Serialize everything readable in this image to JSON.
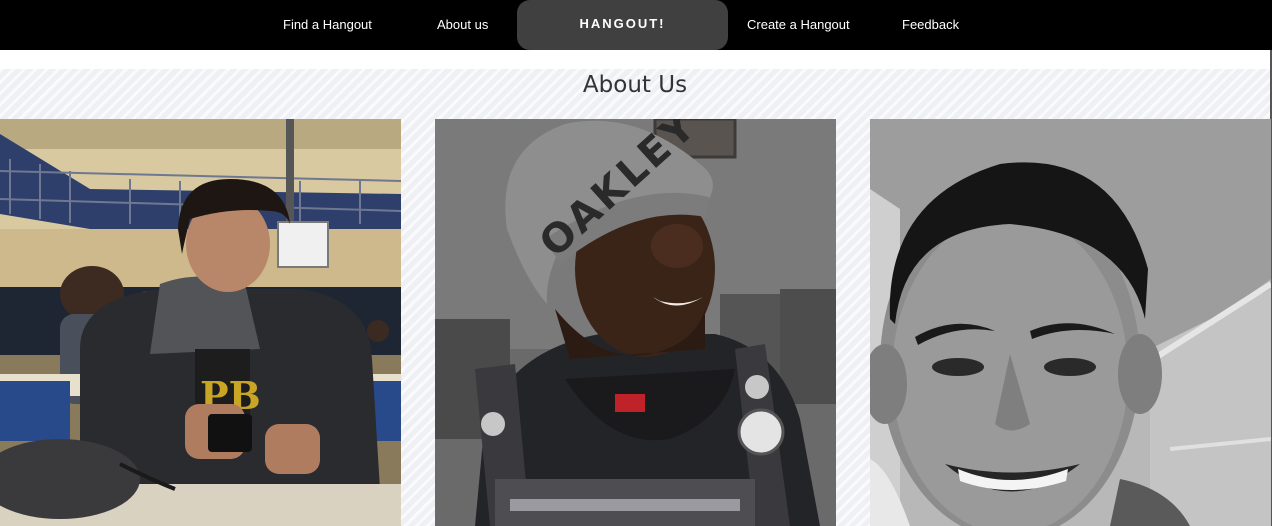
{
  "nav": {
    "links": [
      "Find a Hangout",
      "About us",
      "Create a Hangout",
      "Feedback"
    ],
    "brand": "HANGOUT!"
  },
  "section": {
    "title": "About Us"
  },
  "photos": [
    {
      "alt": "Team member in a gymnasium holding a phone"
    },
    {
      "alt": "Team member wearing a grey OAKLEY beanie"
    },
    {
      "alt": "Team member smiling in a black and white photo"
    }
  ],
  "colors": {
    "nav_bg": "#000000",
    "brand_bg": "#404040",
    "section_bg": "#f4f5f8"
  },
  "icons": {
    "beanie_text": "OAKLEY"
  }
}
